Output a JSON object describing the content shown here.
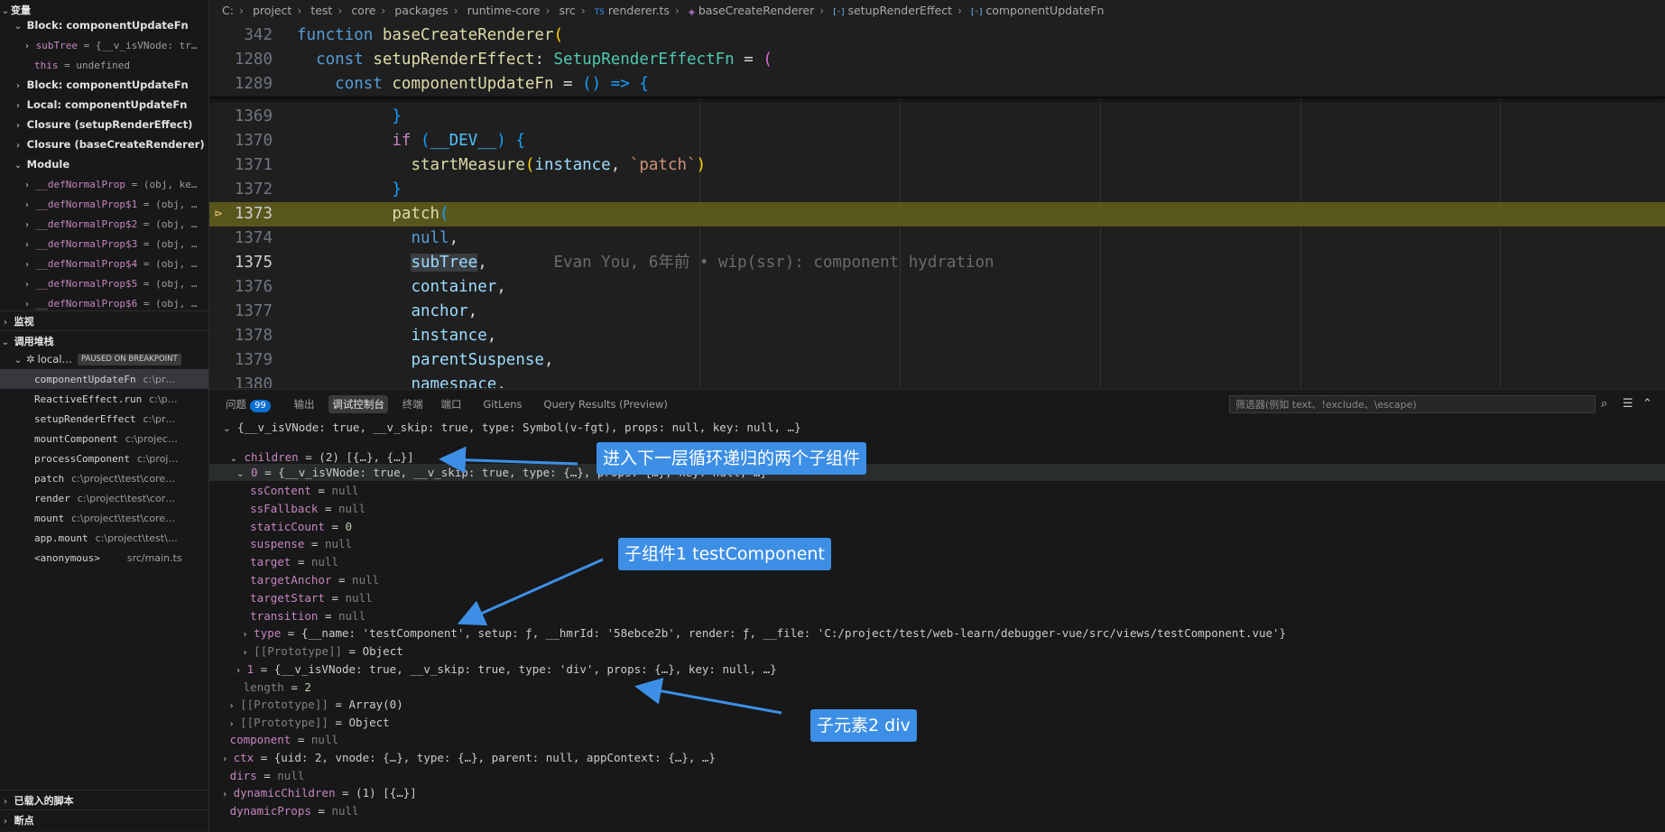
{
  "sidebar": {
    "variables_header": "变量",
    "scopes": [
      {
        "label": "Block: componentUpdateFn",
        "expanded": true
      },
      {
        "label": "Block: componentUpdateFn",
        "expanded": false
      },
      {
        "label": "Local: componentUpdateFn",
        "expanded": true
      },
      {
        "label": "Closure (setupRenderEffect)",
        "expanded": false
      },
      {
        "label": "Closure (baseCreateRenderer)",
        "expanded": false
      },
      {
        "label": "Module",
        "expanded": true
      }
    ],
    "block_vars": [
      {
        "name": "subTree",
        "value": " = {__v_isVNode: tr…"
      },
      {
        "name": "this",
        "value": " = undefined"
      }
    ],
    "module_vars": [
      {
        "name": "__defNormalProp",
        "value": " = (obj, ke…"
      },
      {
        "name": "__defNormalProp$1",
        "value": " = (obj, …"
      },
      {
        "name": "__defNormalProp$2",
        "value": " = (obj, …"
      },
      {
        "name": "__defNormalProp$3",
        "value": " = (obj, …"
      },
      {
        "name": "__defNormalProp$4",
        "value": " = (obj, …"
      },
      {
        "name": "__defNormalProp$5",
        "value": " = (obj, …"
      },
      {
        "name": "__defNormalProp$6",
        "value": " = (obj, …"
      }
    ],
    "watch_header": "监视",
    "callstack_header": "调用堆栈",
    "session_label": "local…",
    "paused_badge": "PAUSED ON BREAKPOINT",
    "frames": [
      {
        "name": "componentUpdateFn",
        "path": "c:\\pr…"
      },
      {
        "name": "ReactiveEffect.run",
        "path": "c:\\p…"
      },
      {
        "name": "setupRenderEffect",
        "path": "c:\\pr…"
      },
      {
        "name": "mountComponent",
        "path": "c:\\projec…"
      },
      {
        "name": "processComponent",
        "path": "c:\\proj…"
      },
      {
        "name": "patch",
        "path": "c:\\project\\test\\core…"
      },
      {
        "name": "render",
        "path": "c:\\project\\test\\cor…"
      },
      {
        "name": "mount",
        "path": "c:\\project\\test\\core…"
      },
      {
        "name": "app.mount",
        "path": "c:\\project\\test\\…"
      },
      {
        "name": "<anonymous>",
        "path": "src/main.ts"
      }
    ],
    "loaded_scripts_header": "已载入的脚本",
    "breakpoints_header": "断点"
  },
  "editor": {
    "breadcrumb": [
      "C:",
      "project",
      "test",
      "core",
      "packages",
      "runtime-core",
      "src",
      "renderer.ts",
      "baseCreateRenderer",
      "setupRenderEffect",
      "componentUpdateFn"
    ],
    "line_numbers": [
      "342",
      "1280",
      "1289",
      "1369",
      "1370",
      "1371",
      "1372",
      "1373",
      "1374",
      "1375",
      "1376",
      "1377",
      "1378",
      "1379",
      "1380"
    ],
    "code": {
      "l342_kw": "function",
      "l342_fn": "baseCreateRenderer",
      "l1280_kw": "const",
      "l1280_name": "setupRenderEffect",
      "l1280_type": "SetupRenderEffectFn",
      "l1289_kw": "const",
      "l1289_fn": "componentUpdateFn",
      "l1289_arrow": "() =>",
      "l1370_kw": "if",
      "l1370_const": "__DEV__",
      "l1371_fn": "startMeasure",
      "l1371_arg": "instance",
      "l1371_str": "`patch`",
      "l1373_fn": "patch",
      "l1374_kw": "null",
      "l1375_var": "subTree",
      "l1376_var": "container",
      "l1377_var": "anchor",
      "l1378_var": "instance",
      "l1379_var": "parentSuspense",
      "l1380_var": "namespace"
    },
    "blame": "Evan You, 6年前 • wip(ssr): component hydration"
  },
  "panel": {
    "tabs": {
      "problems": "问题",
      "problems_count": "99",
      "output": "输出",
      "debug_console": "调试控制台",
      "terminal": "终端",
      "ports": "端口",
      "gitlens": "GitLens",
      "query": "Query Results (Preview)"
    },
    "filter_placeholder": "筛选器(例如 text、!exclude、\\escape)",
    "rows": {
      "r0": "{__v_isVNode: true, __v_skip: true, type: Symbol(v-fgt), props: null, key: null, …}",
      "children_key": "children",
      "children_val": " = (2) [{…}, {…}]",
      "item0_key": "0",
      "item0_val": " = {__v_isVNode: true, __v_skip: true, type: {…}, props: {…}, key: null, …}",
      "ssContent_key": "ssContent",
      "ssFallback_key": "ssFallback",
      "staticCount_key": "staticCount",
      "staticCount_val": "0",
      "suspense_key": "suspense",
      "target_key": "target",
      "targetAnchor_key": "targetAnchor",
      "targetStart_key": "targetStart",
      "transition_key": "transition",
      "null_val": "null",
      "type_key": "type",
      "type_val": " = {__name: 'testComponent', setup: ƒ, __hmrId: '58ebce2b', render: ƒ, __file: 'C:/project/test/web-learn/debugger-vue/src/views/testComponent.vue'}",
      "proto_key": "[[Prototype]]",
      "proto_obj": "Object",
      "item1_key": "1",
      "item1_val": " = {__v_isVNode: true, __v_skip: true, type: 'div', props: {…}, key: null, …}",
      "length_key": "length",
      "length_val": "2",
      "proto_arr": "Array(0)",
      "component_key": "component",
      "ctx_key": "ctx",
      "ctx_val": " = {uid: 2, vnode: {…}, type: {…}, parent: null, appContext: {…}, …}",
      "dirs_key": "dirs",
      "dynamicChildren_key": "dynamicChildren",
      "dynamicChildren_val": " = (1) [{…}]",
      "dynamicProps_key": "dynamicProps"
    }
  },
  "annotations": {
    "a1": "进入下一层循环递归的两个子组件",
    "a2": "子组件1 testComponent",
    "a3": "子元素2 div"
  },
  "colors": {
    "accent": "#3d8fe6",
    "breakpoint": "#e5c07b",
    "highlight": "#58561c"
  }
}
